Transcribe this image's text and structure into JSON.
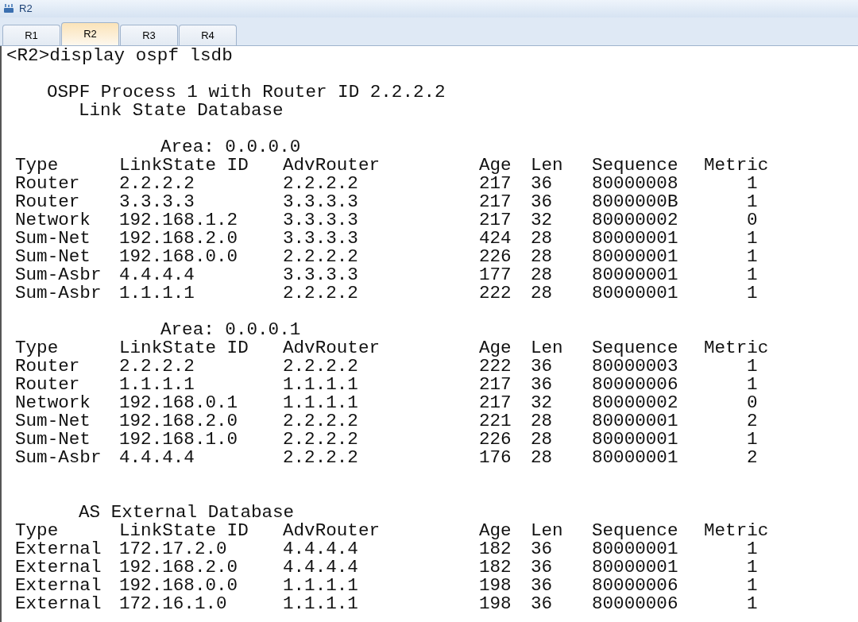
{
  "window": {
    "title": "R2"
  },
  "tabs": [
    {
      "label": "R1",
      "selected": false
    },
    {
      "label": "R2",
      "selected": true
    },
    {
      "label": "R3",
      "selected": false
    },
    {
      "label": "R4",
      "selected": false
    }
  ],
  "terminal": {
    "command": "<R2>display ospf lsdb",
    "process_line": "OSPF Process 1 with Router ID 2.2.2.2",
    "database_title": "Link State Database",
    "sections": [
      {
        "kind": "area",
        "title": "Area: 0.0.0.0",
        "columns": [
          "Type",
          "LinkState ID",
          "AdvRouter",
          "Age",
          "Len",
          "Sequence",
          "Metric"
        ],
        "rows": [
          [
            "Router",
            "2.2.2.2",
            "2.2.2.2",
            "217",
            "36",
            "80000008",
            "1"
          ],
          [
            "Router",
            "3.3.3.3",
            "3.3.3.3",
            "217",
            "36",
            "8000000B",
            "1"
          ],
          [
            "Network",
            "192.168.1.2",
            "3.3.3.3",
            "217",
            "32",
            "80000002",
            "0"
          ],
          [
            "Sum-Net",
            "192.168.2.0",
            "3.3.3.3",
            "424",
            "28",
            "80000001",
            "1"
          ],
          [
            "Sum-Net",
            "192.168.0.0",
            "2.2.2.2",
            "226",
            "28",
            "80000001",
            "1"
          ],
          [
            "Sum-Asbr",
            "4.4.4.4",
            "3.3.3.3",
            "177",
            "28",
            "80000001",
            "1"
          ],
          [
            "Sum-Asbr",
            "1.1.1.1",
            "2.2.2.2",
            "222",
            "28",
            "80000001",
            "1"
          ]
        ]
      },
      {
        "kind": "area",
        "title": "Area: 0.0.0.1",
        "columns": [
          "Type",
          "LinkState ID",
          "AdvRouter",
          "Age",
          "Len",
          "Sequence",
          "Metric"
        ],
        "rows": [
          [
            "Router",
            "2.2.2.2",
            "2.2.2.2",
            "222",
            "36",
            "80000003",
            "1"
          ],
          [
            "Router",
            "1.1.1.1",
            "1.1.1.1",
            "217",
            "36",
            "80000006",
            "1"
          ],
          [
            "Network",
            "192.168.0.1",
            "1.1.1.1",
            "217",
            "32",
            "80000002",
            "0"
          ],
          [
            "Sum-Net",
            "192.168.2.0",
            "2.2.2.2",
            "221",
            "28",
            "80000001",
            "2"
          ],
          [
            "Sum-Net",
            "192.168.1.0",
            "2.2.2.2",
            "226",
            "28",
            "80000001",
            "1"
          ],
          [
            "Sum-Asbr",
            "4.4.4.4",
            "2.2.2.2",
            "176",
            "28",
            "80000001",
            "2"
          ]
        ]
      },
      {
        "kind": "external",
        "title": "AS External Database",
        "columns": [
          "Type",
          "LinkState ID",
          "AdvRouter",
          "Age",
          "Len",
          "Sequence",
          "Metric"
        ],
        "rows": [
          [
            "External",
            "172.17.2.0",
            "4.4.4.4",
            "182",
            "36",
            "80000001",
            "1"
          ],
          [
            "External",
            "192.168.2.0",
            "4.4.4.4",
            "182",
            "36",
            "80000001",
            "1"
          ],
          [
            "External",
            "192.168.0.0",
            "1.1.1.1",
            "198",
            "36",
            "80000006",
            "1"
          ],
          [
            "External",
            "172.16.1.0",
            "1.1.1.1",
            "198",
            "36",
            "80000006",
            "1"
          ]
        ]
      }
    ]
  }
}
